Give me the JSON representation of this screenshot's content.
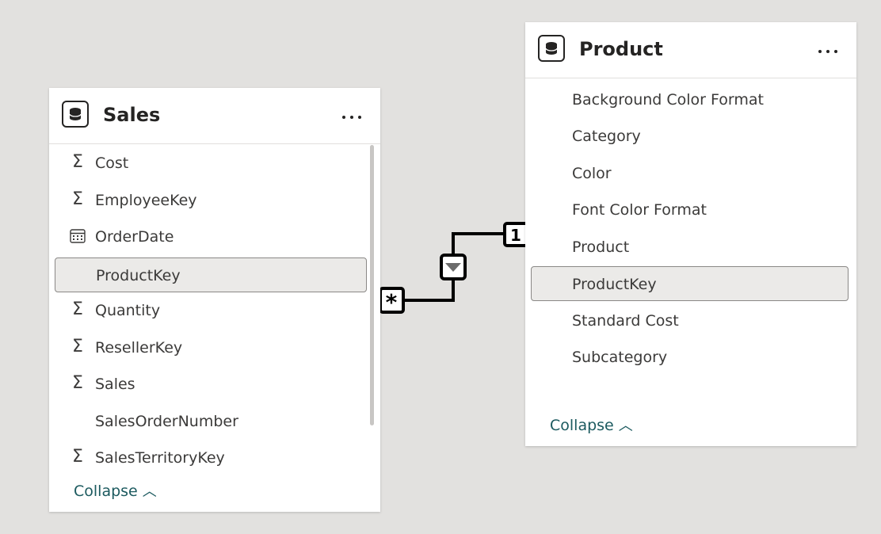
{
  "sales": {
    "title": "Sales",
    "fields": [
      {
        "label": "Cost",
        "icon": "sigma-icon"
      },
      {
        "label": "EmployeeKey",
        "icon": "sigma-icon"
      },
      {
        "label": "OrderDate",
        "icon": "calendar-icon"
      },
      {
        "label": "ProductKey",
        "icon": "",
        "selected": true
      },
      {
        "label": "Quantity",
        "icon": "sigma-icon"
      },
      {
        "label": "ResellerKey",
        "icon": "sigma-icon"
      },
      {
        "label": "Sales",
        "icon": "sigma-icon"
      },
      {
        "label": "SalesOrderNumber",
        "icon": ""
      },
      {
        "label": "SalesTerritoryKey",
        "icon": "sigma-icon"
      }
    ],
    "collapse_label": "Collapse"
  },
  "product": {
    "title": "Product",
    "fields": [
      {
        "label": "Background Color Format"
      },
      {
        "label": "Category"
      },
      {
        "label": "Color"
      },
      {
        "label": "Font Color Format"
      },
      {
        "label": "Product"
      },
      {
        "label": "ProductKey",
        "selected": true
      },
      {
        "label": "Standard Cost"
      },
      {
        "label": "Subcategory"
      }
    ],
    "collapse_label": "Collapse"
  },
  "relationship": {
    "many_marker": "*",
    "one_marker": "1",
    "filter_direction": "single"
  },
  "colors": {
    "canvas": "#e2e1df",
    "accent_link": "#1c5a5f",
    "selected_row": "#ebeae8"
  }
}
